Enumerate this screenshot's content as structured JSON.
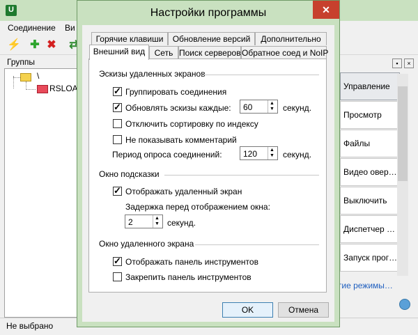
{
  "main": {
    "menu": [
      "Соединение",
      "Ви"
    ],
    "groups_label": "Группы",
    "tree": {
      "root": "\\",
      "child": "RSLOAD"
    },
    "status": "Не выбрано",
    "right_panel": {
      "items": [
        "Управление",
        "Просмотр",
        "Файлы",
        "Видео овер…",
        "Выключить",
        "Диспетчер …",
        "Запуск прог…"
      ],
      "more_link": "гие режимы…"
    }
  },
  "dialog": {
    "title": "Настройки программы",
    "close_glyph": "✕",
    "tabs_top": [
      "Горячие клавиши",
      "Обновление версий",
      "Дополнительно"
    ],
    "tabs_bottom": [
      "Внешний вид",
      "Сеть",
      "Поиск серверов",
      "Обратное соед и NoIP"
    ],
    "sections": {
      "thumbnails": {
        "title": "Эскизы удаленных экранов",
        "group_connections": {
          "label": "Группировать соединения",
          "checked": true
        },
        "update_thumbnails": {
          "label": "Обновлять эскизы каждые:",
          "checked": true,
          "value": "60",
          "unit": "секунд."
        },
        "disable_sorting": {
          "label": "Отключить сортировку по индексу",
          "checked": false
        },
        "hide_comments": {
          "label": "Не показывать комментарий",
          "checked": false
        },
        "poll_period": {
          "label": "Период опроса соединений:",
          "value": "120",
          "unit": "секунд."
        }
      },
      "tooltip": {
        "title": "Окно подсказки",
        "show_remote": {
          "label": "Отображать удаленный экран",
          "checked": true
        },
        "delay_label": "Задержка перед отображением окна:",
        "delay_value": "2",
        "delay_unit": "секунд."
      },
      "remote_window": {
        "title": "Окно удаленного экрана",
        "show_toolbar": {
          "label": "Отображать панель инструментов",
          "checked": true
        },
        "pin_toolbar": {
          "label": "Закрепить панель инструментов",
          "checked": false
        }
      }
    },
    "buttons": {
      "ok": "OK",
      "cancel": "Отмена"
    }
  }
}
